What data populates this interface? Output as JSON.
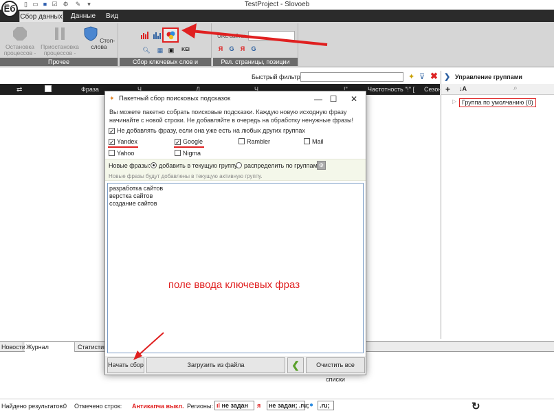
{
  "window": {
    "title": "TestProject - Slovoeb",
    "logo": "Ёб"
  },
  "ribbon_tabs": [
    "Сбор данных",
    "Данные",
    "Вид"
  ],
  "ribbon": {
    "other_group": {
      "label": "Прочее",
      "stop_processes": "Остановка процессов -",
      "pause_processes": "Приостановка процессов -",
      "stop_words": "Стоп-слова"
    },
    "keywords_group_label": "Сбор ключевых слов и статистики",
    "keyi_label": "KEI",
    "rel_group": {
      "label": "Рел. страницы, позиции",
      "url_label": "URL сайта:"
    }
  },
  "filter": {
    "label": "Быстрый фильтр:",
    "value": ""
  },
  "grid": {
    "columns": [
      "Фраза",
      "Ч",
      "Д",
      "Ч",
      "!\"",
      "Частотность \"!\" [",
      "Сезон"
    ]
  },
  "right_panel": {
    "title": "Управление группами",
    "group_item": "Группа по умолчанию (0)"
  },
  "bottom_tabs": [
    "Новости",
    "Журнал событий",
    "Статистика"
  ],
  "status": {
    "found_label": "Найдено результатов:",
    "found_value": "0",
    "marked_label": "Отмечено строк:",
    "anticaptcha": "Антикапча выкл.",
    "regions_label": "Регионы:",
    "region1": "не задан",
    "region2": "не задан; .ru;",
    "region3": ".ru;"
  },
  "dialog": {
    "title": "Пакетный сбор поисковых подсказок",
    "info": "Вы можете пакетно собрать поисковые подсказки. Каждую новую исходную фразу начинайте с новой строки. Не добавляйте в очередь на обработку ненужные фразы!",
    "skip_existing": "Не добавлять фразу, если она уже есть на любых других группах",
    "engines": [
      {
        "name": "Yandex",
        "checked": true
      },
      {
        "name": "Google",
        "checked": true
      },
      {
        "name": "Rambler",
        "checked": false
      },
      {
        "name": "Mail",
        "checked": false
      },
      {
        "name": "Yahoo",
        "checked": false
      },
      {
        "name": "Nigma",
        "checked": false
      }
    ],
    "new_phrases_label": "Новые фразы:",
    "option_add": "добавить в текущую группу",
    "option_distribute": "распределить по группам",
    "new_phrases_note": "Новые фразы будут добавлены в текущую активную группу.",
    "phrases": [
      "разработка сайтов",
      "верстка сайтов",
      "создание сайтов"
    ],
    "annotation": "поле ввода ключевых фраз",
    "start_button": "Начать сбор",
    "load_button": "Загрузить из файла",
    "clear_button": "Очистить все списки"
  },
  "colors": {
    "accent_red": "#e02020",
    "ribbon_dark": "#2b2b2b"
  }
}
